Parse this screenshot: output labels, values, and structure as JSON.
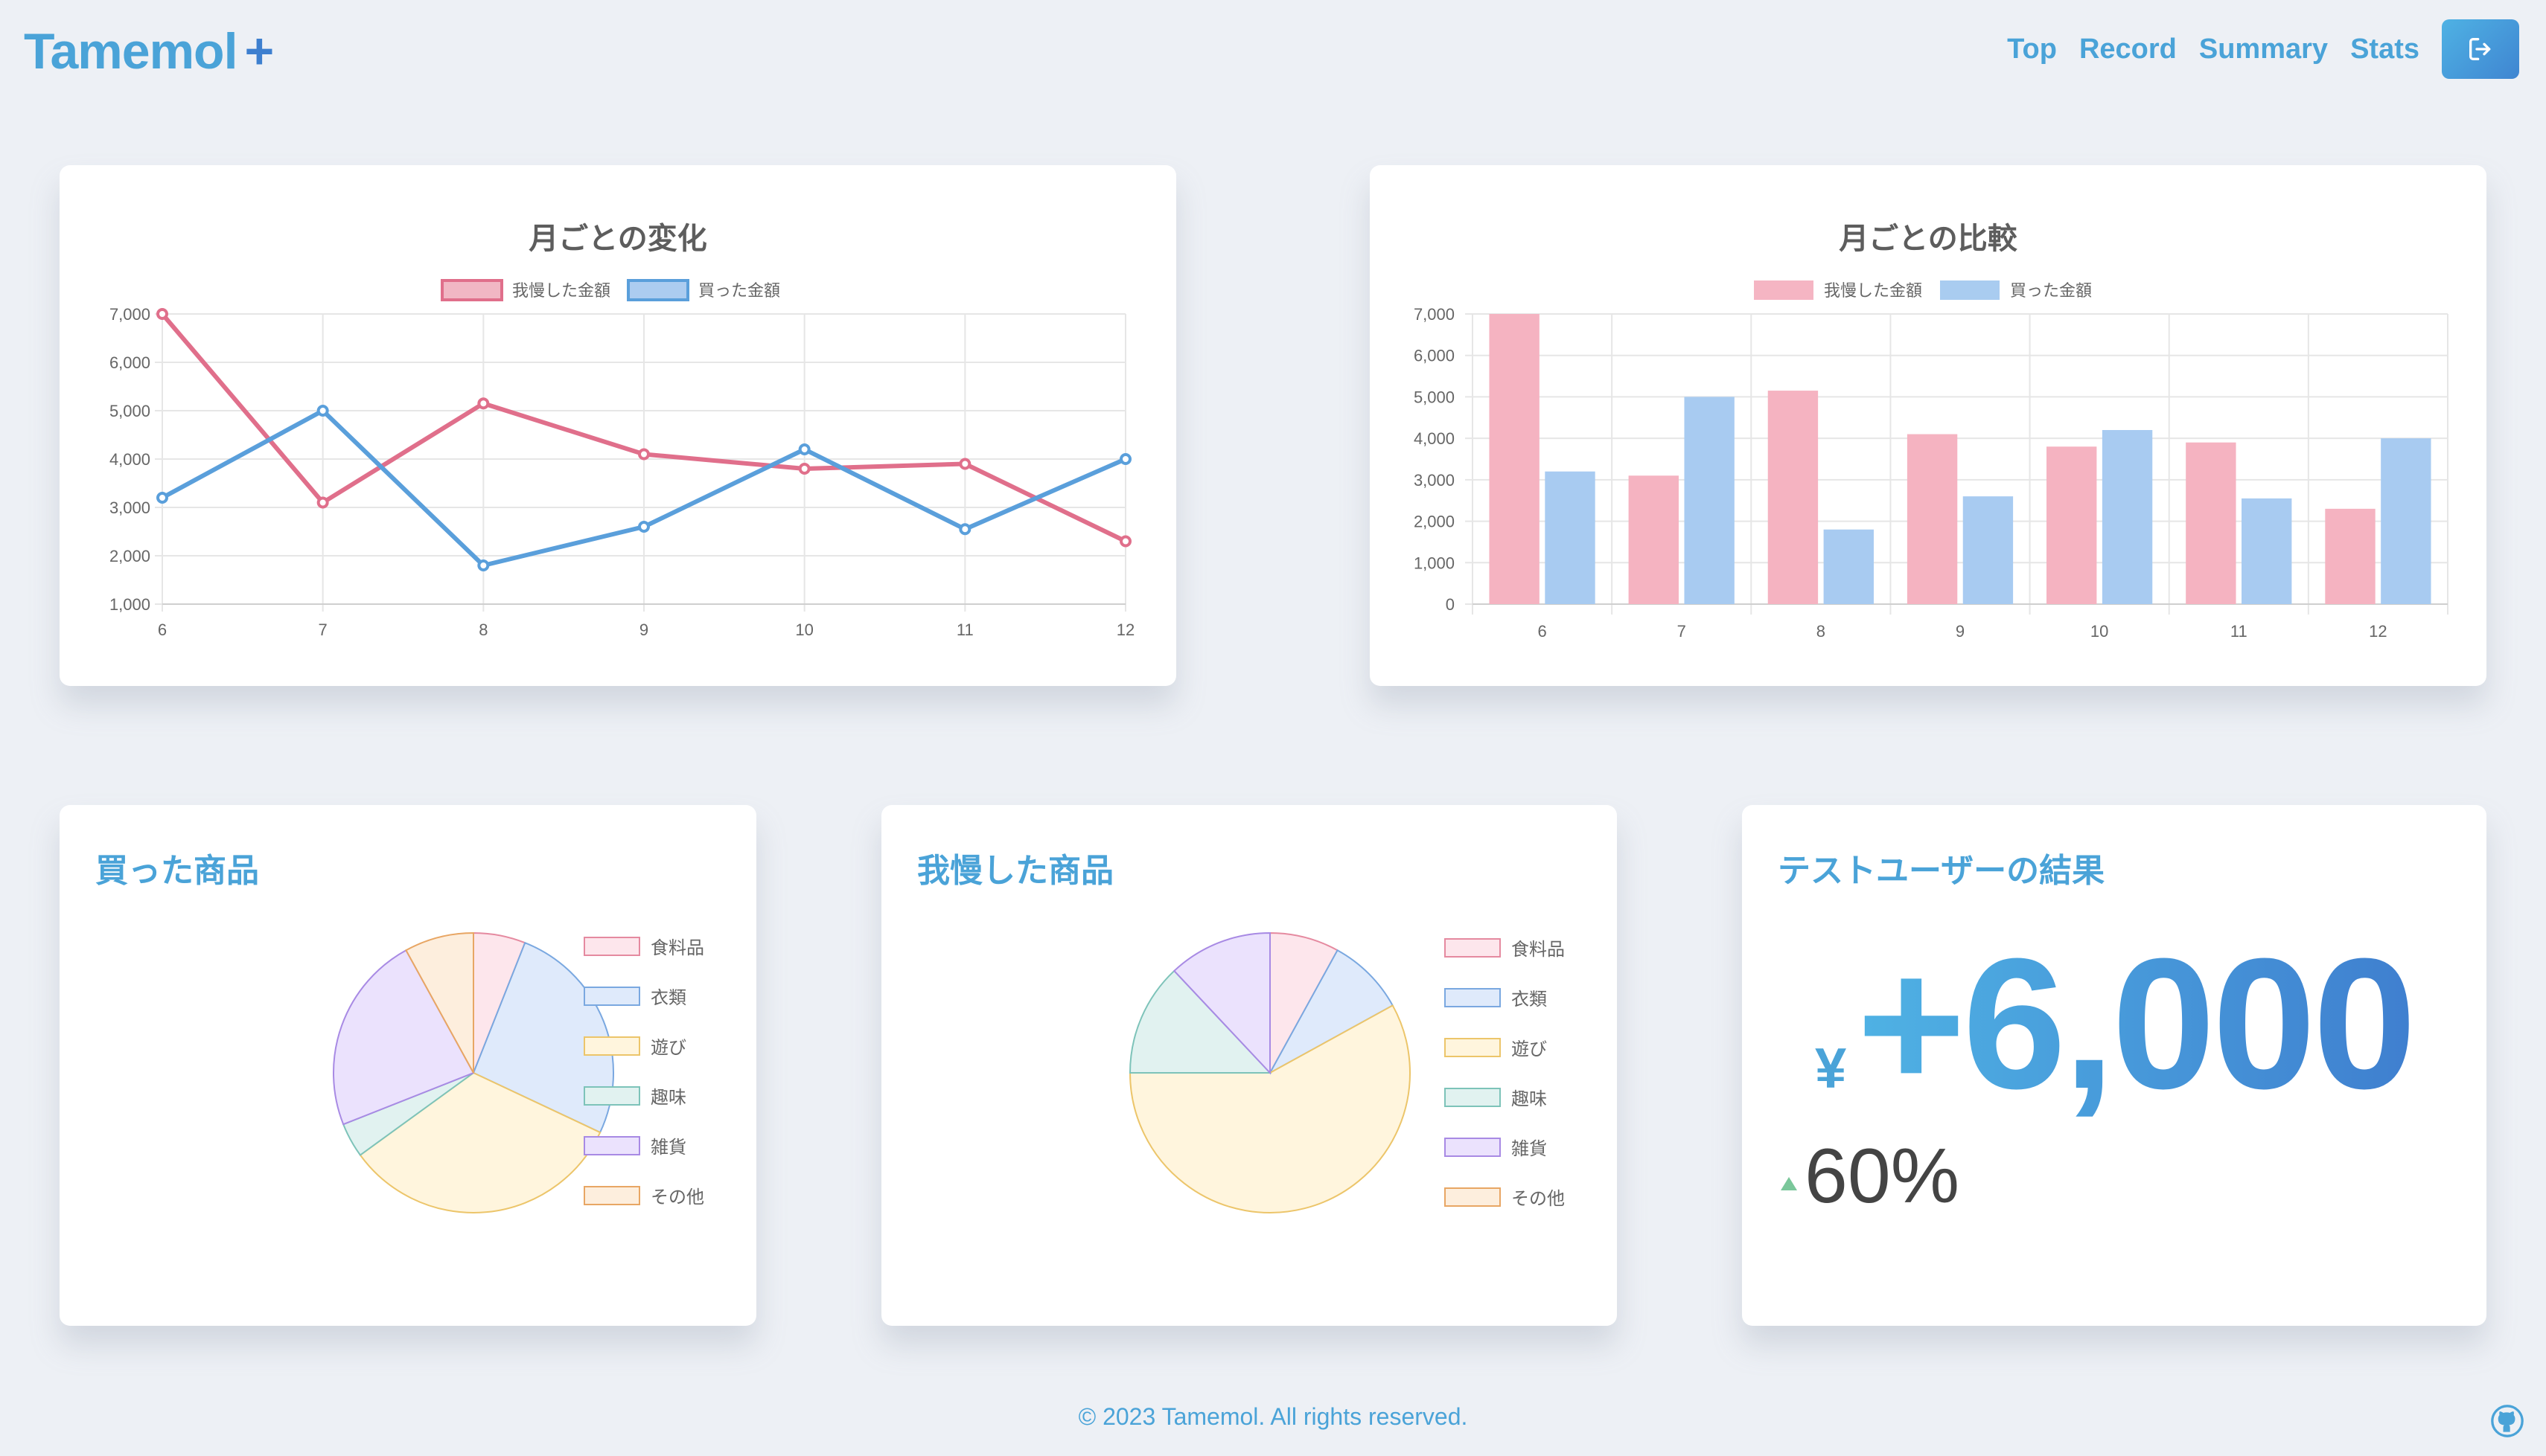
{
  "brand": {
    "name": "Tamemol",
    "plus": "+"
  },
  "nav": {
    "items": [
      "Top",
      "Record",
      "Summary",
      "Stats"
    ],
    "logout_icon": "logout-icon"
  },
  "colors": {
    "accent": "#4aa3d8",
    "endured": "#e06f8b",
    "bought": "#5a9fdb",
    "up": "#7ac79a"
  },
  "monthly_change": {
    "title": "月ごとの変化",
    "legend": [
      "我慢した金額",
      "買った金額"
    ],
    "chart_data": {
      "type": "line",
      "title": "月ごとの変化",
      "categories": [
        "6",
        "7",
        "8",
        "9",
        "10",
        "11",
        "12"
      ],
      "series": [
        {
          "name": "我慢した金額",
          "values": [
            7000,
            3100,
            5150,
            4100,
            3800,
            3900,
            2300
          ]
        },
        {
          "name": "買った金額",
          "values": [
            3200,
            5000,
            1800,
            2600,
            4200,
            2550,
            4000
          ]
        }
      ],
      "yticks": [
        "1,000",
        "2,000",
        "3,000",
        "4,000",
        "5,000",
        "6,000",
        "7,000"
      ],
      "ylim": [
        1000,
        7000
      ],
      "grid": true,
      "legend_position": "top"
    }
  },
  "monthly_compare": {
    "title": "月ごとの比較",
    "legend": [
      "我慢した金額",
      "買った金額"
    ],
    "chart_data": {
      "type": "bar",
      "title": "月ごとの比較",
      "categories": [
        "6",
        "7",
        "8",
        "9",
        "10",
        "11",
        "12"
      ],
      "series": [
        {
          "name": "我慢した金額",
          "values": [
            7000,
            3100,
            5150,
            4100,
            3800,
            3900,
            2300
          ]
        },
        {
          "name": "買った金額",
          "values": [
            3200,
            5000,
            1800,
            2600,
            4200,
            2550,
            4000
          ]
        }
      ],
      "yticks": [
        "0",
        "1,000",
        "2,000",
        "3,000",
        "4,000",
        "5,000",
        "6,000",
        "7,000"
      ],
      "ylim": [
        0,
        7000
      ],
      "grid": true,
      "legend_position": "top"
    }
  },
  "bought_items": {
    "title": "買った商品",
    "legend": [
      "食料品",
      "衣類",
      "遊び",
      "趣味",
      "雑貨",
      "その他"
    ],
    "chart_data": {
      "type": "pie",
      "categories": [
        "食料品",
        "衣類",
        "遊び",
        "趣味",
        "雑貨",
        "その他"
      ],
      "values": [
        6,
        26,
        33,
        4,
        23,
        8
      ]
    }
  },
  "endured_items": {
    "title": "我慢した商品",
    "legend": [
      "食料品",
      "衣類",
      "遊び",
      "趣味",
      "雑貨",
      "その他"
    ],
    "chart_data": {
      "type": "pie",
      "categories": [
        "食料品",
        "衣類",
        "遊び",
        "趣味",
        "雑貨",
        "その他"
      ],
      "values": [
        8,
        9,
        58,
        13,
        12,
        0
      ]
    }
  },
  "result": {
    "title": "テストユーザーの結果",
    "currency": "¥",
    "amount": "+6,000",
    "change_icon": "triangle-up-icon",
    "change": "60%"
  },
  "pie_palette": [
    {
      "fill": "#fde6ec",
      "stroke": "#e58aa0"
    },
    {
      "fill": "#dfeafb",
      "stroke": "#7aa8e0"
    },
    {
      "fill": "#fff5dd",
      "stroke": "#ecc56a"
    },
    {
      "fill": "#e1f2f0",
      "stroke": "#7dc3b9"
    },
    {
      "fill": "#ebe2fd",
      "stroke": "#a88ae4"
    },
    {
      "fill": "#fdeedd",
      "stroke": "#e8a664"
    }
  ],
  "footer": "© 2023 Tamemol. All rights reserved.",
  "github_icon": "github-icon"
}
